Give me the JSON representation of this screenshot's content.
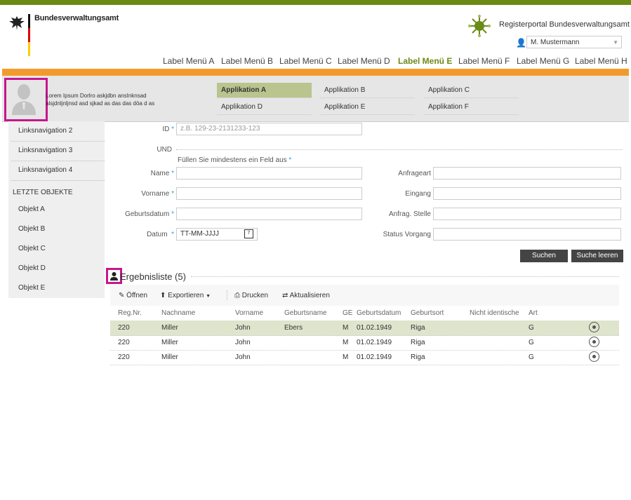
{
  "header": {
    "org_name": "Bundesverwaltungsamt",
    "portal_name": "Registerportal  Bundesverwaltungsamt",
    "user_selected": "M. Mustermann"
  },
  "menu": [
    {
      "label": "Label Menü A",
      "active": false
    },
    {
      "label": "Label Menü B",
      "active": false
    },
    {
      "label": "Label Menü C",
      "active": false
    },
    {
      "label": "Label Menü  D",
      "active": false
    },
    {
      "label": "Label Menü E",
      "active": true
    },
    {
      "label": "Label Menü F",
      "active": false
    },
    {
      "label": "Label Menü G",
      "active": false
    },
    {
      "label": "Label Menü H",
      "active": false
    }
  ],
  "user_panel": {
    "text_line1": "Lorem Ipsum Dorlro askjdbn ansInknsad",
    "text_line2": "alsjdnljnljnsd asd sjkad as das das döa d as"
  },
  "apps": [
    {
      "label": "Applikation A",
      "active": true
    },
    {
      "label": "Applikation B",
      "active": false
    },
    {
      "label": "Applikation C",
      "active": false
    },
    {
      "label": "Applikation D",
      "active": false
    },
    {
      "label": "Applikation E",
      "active": false
    },
    {
      "label": "Applikation F",
      "active": false
    }
  ],
  "sidebar": {
    "links": [
      "Linksnavigation 2",
      "Linksnavigation 3",
      "Linksnavigation 4"
    ],
    "recent_heading": "LETZTE OBJEKTE",
    "objects": [
      "Objekt A",
      "Objekt B",
      "Objekt C",
      "Objekt D",
      "Objekt E"
    ]
  },
  "form": {
    "id_label": "ID",
    "id_placeholder": "z.B. 129-23-2131233-123",
    "und_label": "UND",
    "hint": "Füllen Sie mindestens ein Feld aus",
    "name_label": "Name",
    "vorname_label": "Vorname",
    "geburtsdatum_label": "Geburtsdatum",
    "datum_label": "Datum",
    "datum_value": "TT-MM-JJJJ",
    "anfrageart_label": "Anfrageart",
    "eingang_label": "Eingang",
    "anfrag_stelle_label": "Anfrag. Stelle",
    "status_label": "Status Vorgang",
    "req_mark": "*",
    "search_button": "Suchen",
    "clear_button": "Suche leeren"
  },
  "results": {
    "title": "Ergebnisliste (5)",
    "toolbar": {
      "open": "Öffnen",
      "export": "Exportieren",
      "print": "Drucken",
      "refresh": "Aktualisieren"
    },
    "columns": [
      "Reg.Nr.",
      "Nachname",
      "Vorname",
      "Geburtsname",
      "GE",
      "Geburtsdatum",
      "Geburtsort",
      "Nicht identische",
      "Art"
    ],
    "rows": [
      {
        "reg": "220",
        "nachname": "Miller",
        "vorname": "John",
        "geburtsname": "Ebers",
        "ge": "M",
        "geburtsdatum": "01.02.1949",
        "geburtsort": "Riga",
        "nicht_ident": "",
        "art": "G",
        "selected": true
      },
      {
        "reg": "220",
        "nachname": "Miller",
        "vorname": "John",
        "geburtsname": "",
        "ge": "M",
        "geburtsdatum": "01.02.1949",
        "geburtsort": "Riga",
        "nicht_ident": "",
        "art": "G",
        "selected": false
      },
      {
        "reg": "220",
        "nachname": "Miller",
        "vorname": "John",
        "geburtsname": "",
        "ge": "M",
        "geburtsdatum": "01.02.1949",
        "geburtsort": "Riga",
        "nicht_ident": "",
        "art": "G",
        "selected": false
      }
    ]
  },
  "colors": {
    "brand_green": "#6b8a16",
    "orange": "#f39a2f",
    "highlight": "#c6168d",
    "required": "#2ea1d6"
  }
}
